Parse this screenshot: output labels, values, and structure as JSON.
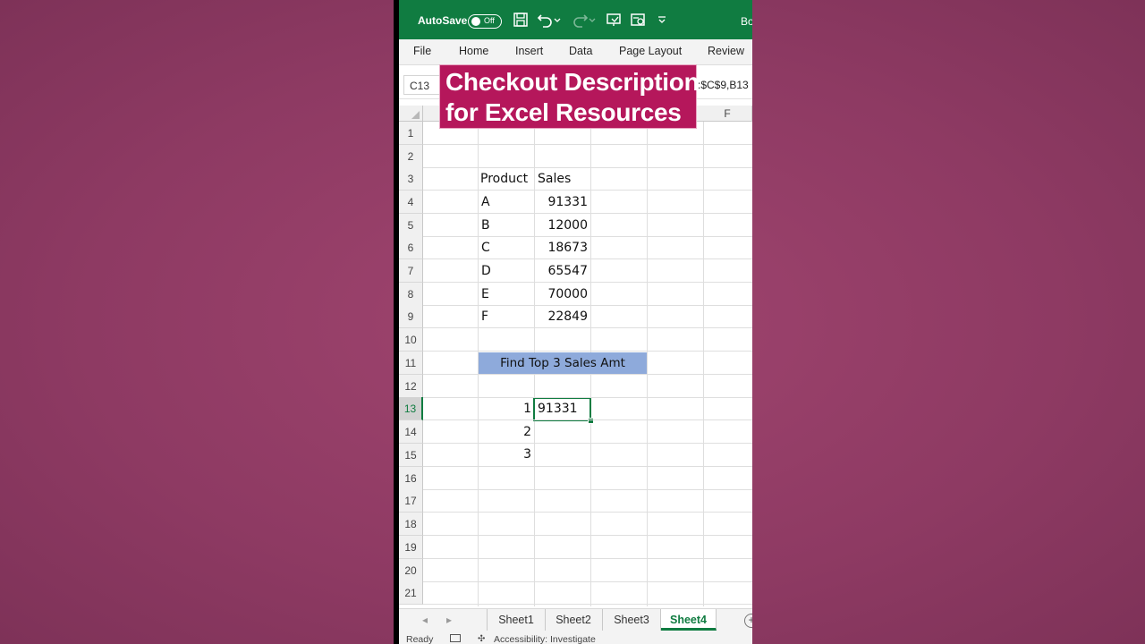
{
  "titlebar": {
    "autosave_label": "AutoSave",
    "autosave_state": "Off",
    "doc_title": "Bo"
  },
  "ribbon": {
    "tabs": [
      "File",
      "Home",
      "Insert",
      "Data",
      "Page Layout",
      "Review"
    ]
  },
  "formula_bar": {
    "name_box": "C13",
    "formula_visible": ":$C$9,B13"
  },
  "columns": {
    "last_visible": "F"
  },
  "rows": [
    "1",
    "2",
    "3",
    "4",
    "5",
    "6",
    "7",
    "8",
    "9",
    "10",
    "11",
    "12",
    "13",
    "14",
    "15",
    "16",
    "17",
    "18",
    "19",
    "20",
    "21"
  ],
  "sheet": {
    "header_product": "Product",
    "header_sales": "Sales",
    "products": [
      "A",
      "B",
      "C",
      "D",
      "E",
      "F"
    ],
    "sales": [
      "91331",
      "12000",
      "18673",
      "65547",
      "70000",
      "22849"
    ],
    "banner": "Find Top 3 Sales Amt",
    "ranks": [
      "1",
      "2",
      "3"
    ],
    "result_c13": "91331"
  },
  "caption": {
    "line1": "Checkout Description",
    "line2": "for Excel Resources"
  },
  "sheet_tabs": [
    "Sheet1",
    "Sheet2",
    "Sheet3",
    "Sheet4"
  ],
  "active_sheet": "Sheet4",
  "status": {
    "ready": "Ready",
    "accessibility": "Accessibility: Investigate"
  },
  "colors": {
    "excel_green": "#107c41",
    "caption_bg": "#b5175b",
    "banner_fill": "#8eaadb",
    "background": "#9a416b"
  }
}
